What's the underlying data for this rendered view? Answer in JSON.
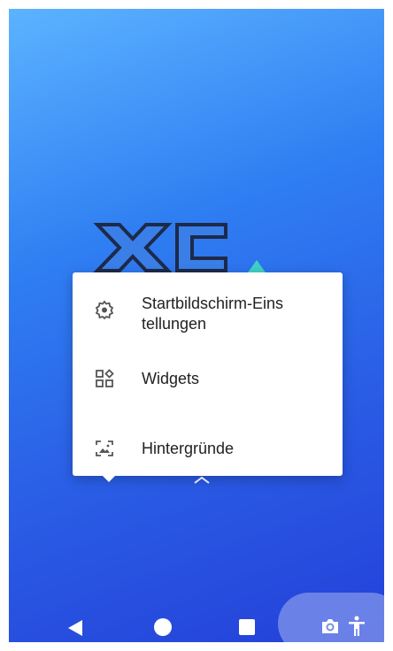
{
  "colors": {
    "popup_bg": "#ffffff",
    "text": "#222222",
    "icon": "#555555",
    "nav_icon": "#ffffff"
  },
  "menu": {
    "items": [
      {
        "label": "Startbildschirm-Einstellungen",
        "label_line1": "Startbildschirm-Eins",
        "label_line2": "tellungen",
        "icon": "gear-icon"
      },
      {
        "label": "Widgets",
        "icon": "widgets-icon"
      },
      {
        "label": "Hintergründe",
        "icon": "wallpaper-icon"
      }
    ]
  },
  "logo": {
    "text": "XC"
  },
  "navigation": {
    "back": "back-icon",
    "home": "home-icon",
    "recents": "recents-icon",
    "camera": "camera-icon",
    "accessibility": "accessibility-icon"
  }
}
